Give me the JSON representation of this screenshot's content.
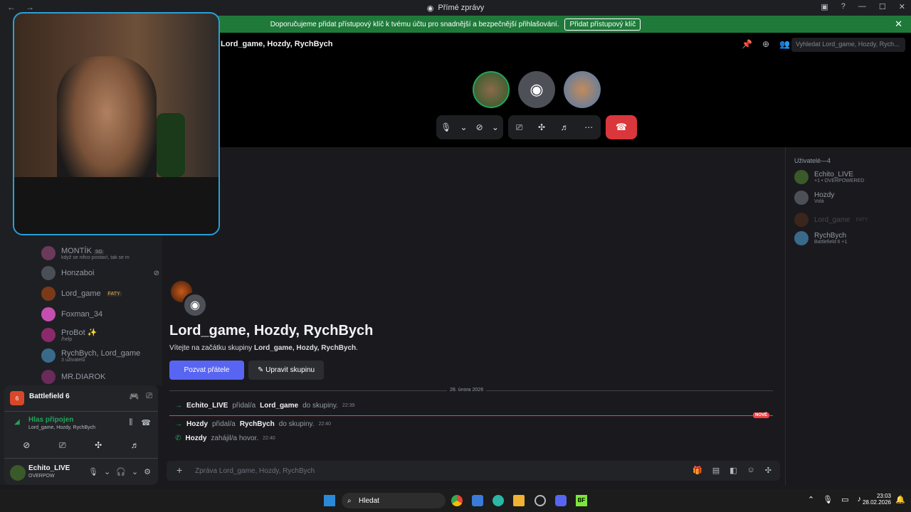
{
  "window": {
    "title": "Přímé zprávy"
  },
  "banner": {
    "text": "Doporučujeme přidat přístupový klíč k tvému účtu pro snadnější a bezpečnější přihlašování.",
    "button": "Přidat přístupový klíč"
  },
  "header": {
    "title": "Lord_game, Hozdy, RychBych",
    "search_placeholder": "Vyhledat Lord_game, Hozdy, Rych..."
  },
  "dm_list": [
    {
      "name": "MONTÍK",
      "tag": "SG",
      "sub": "když se něco postaví, tak se m"
    },
    {
      "name": "Honzaboi",
      "sub": ""
    },
    {
      "name": "Lord_game",
      "tag": "FATY",
      "sub": ""
    },
    {
      "name": "Foxman_34",
      "sub": ""
    },
    {
      "name": "ProBot",
      "sub": "/help"
    },
    {
      "name": "RychBych, Lord_game",
      "sub": "3 uživatelů"
    },
    {
      "name": "MR.DIAROK",
      "sub": ""
    }
  ],
  "activity": {
    "game": "Battlefield 6",
    "voice_status": "Hlas připojen",
    "voice_channel": "Lord_game, Hozdy, RychBych"
  },
  "user": {
    "name": "Echito_LIVE",
    "status": "OVERPOW"
  },
  "group": {
    "title": "Lord_game, Hozdy, RychBych",
    "welcome_prefix": "Vítejte na začátku skupiny ",
    "welcome_names": "Lord_game, Hozdy, RychBych",
    "invite_label": "Pozvat přátele",
    "edit_label": "Upravit skupinu"
  },
  "messages": {
    "date": "28. února 2026",
    "new_label": "NOVÉ",
    "items": [
      {
        "actor": "Echito_LIVE",
        "verb": "přidal/a",
        "target": "Lord_game",
        "rest": "do skupiny.",
        "time": "22:39"
      },
      {
        "actor": "Hozdy",
        "verb": "přidal/a",
        "target": "RychBych",
        "rest": "do skupiny.",
        "time": "22:40"
      },
      {
        "actor": "Hozdy",
        "verb": "zahájil/a hovor.",
        "target": "",
        "rest": "",
        "time": "22:40"
      }
    ]
  },
  "composer": {
    "placeholder": "Zpráva Lord_game, Hozdy, RychBych"
  },
  "members": {
    "header": "Uživatelé—4",
    "items": [
      {
        "name": "Echito_LIVE",
        "status": "+1 • OVERPOWERED"
      },
      {
        "name": "Hozdy",
        "status": "Volá"
      },
      {
        "name": "Lord_game",
        "status": "FATY"
      },
      {
        "name": "RychBych",
        "status": "Battlefield 6 +1"
      }
    ]
  },
  "taskbar": {
    "search": "Hledat",
    "time": "23:03",
    "date": "28.02.2026"
  }
}
